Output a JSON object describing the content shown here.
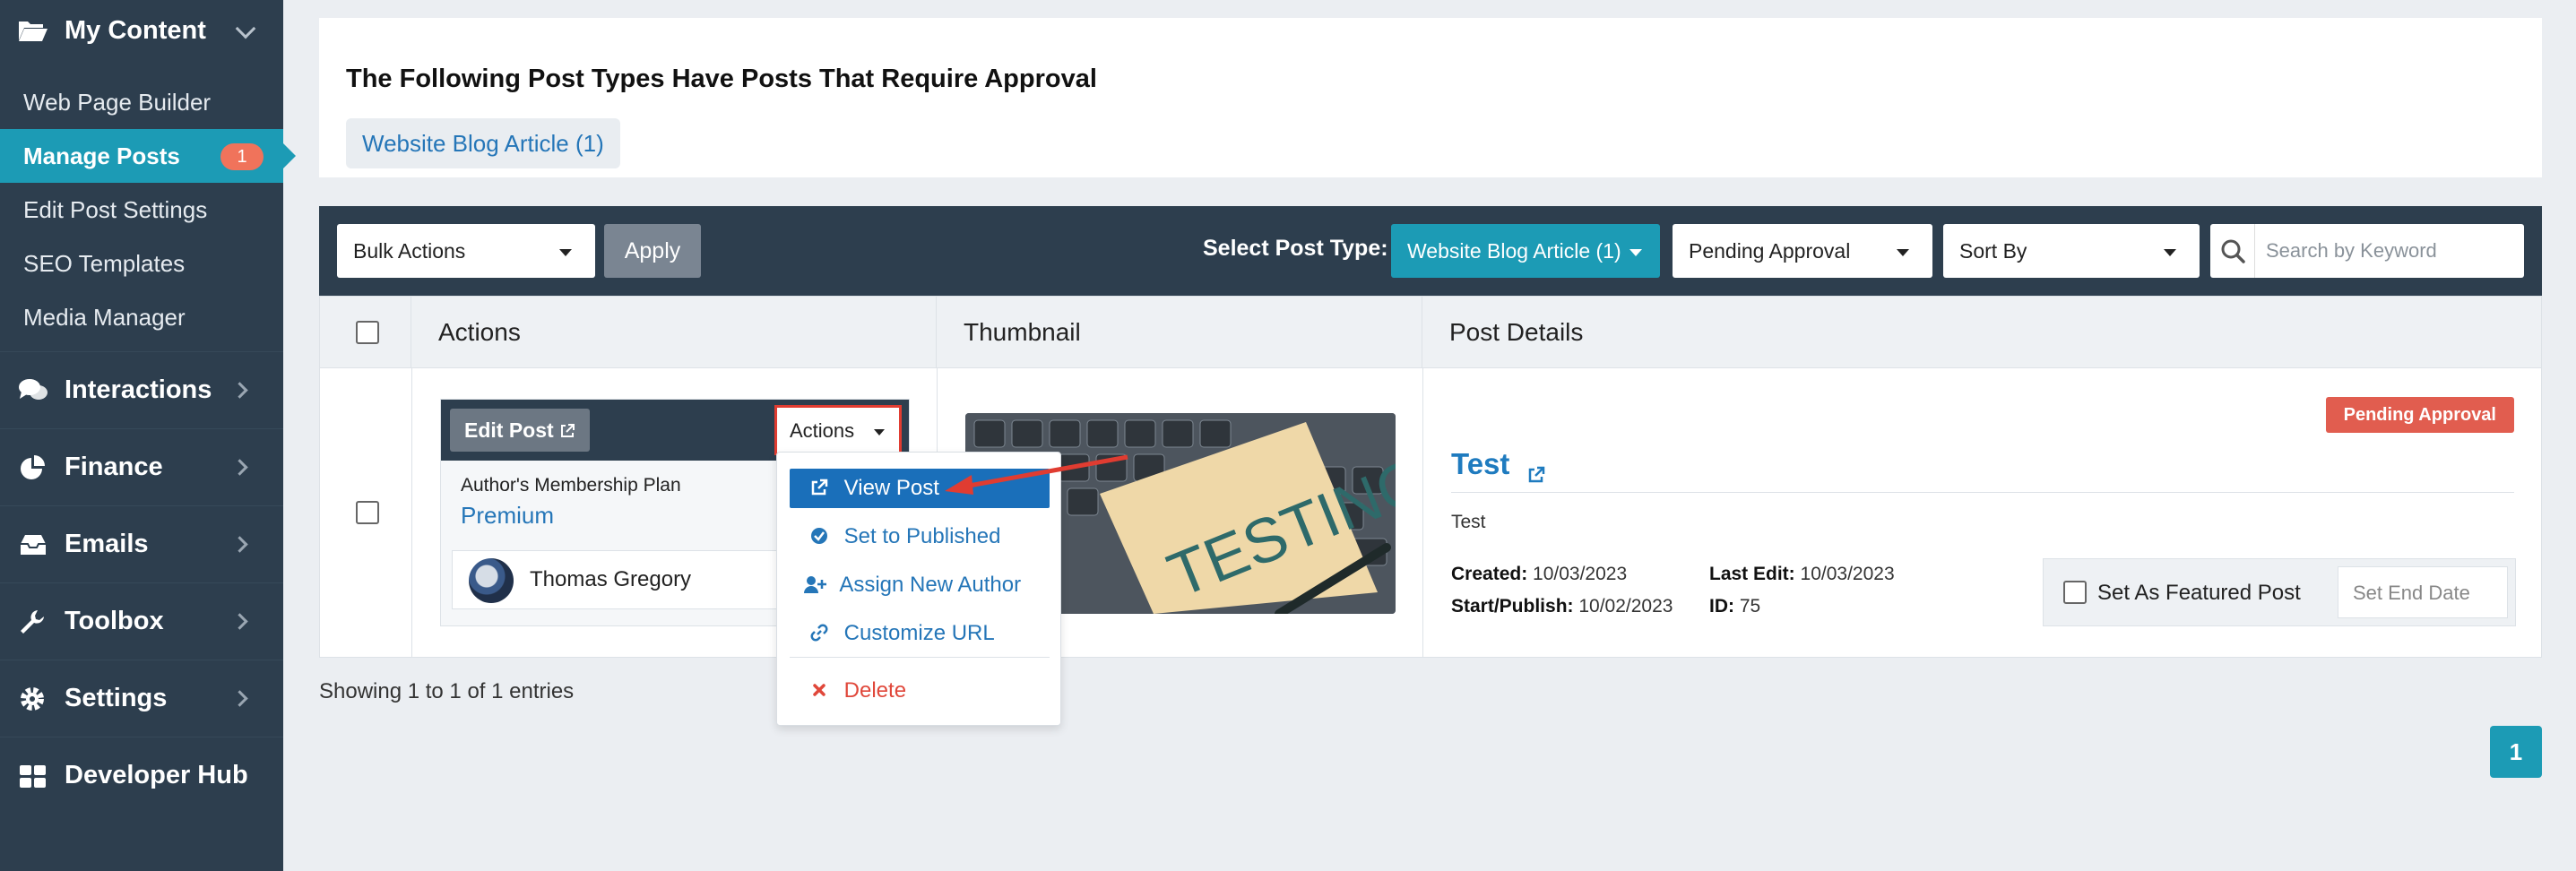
{
  "sidebar": {
    "header": {
      "label": "My Content",
      "icon": "folder-open-icon"
    },
    "sub_items": [
      {
        "label": "Web Page Builder"
      },
      {
        "label": "Manage Posts",
        "badge": "1",
        "active": true
      },
      {
        "label": "Edit Post Settings"
      },
      {
        "label": "SEO Templates"
      },
      {
        "label": "Media Manager"
      }
    ],
    "main_items": [
      {
        "label": "Interactions",
        "icon": "comments-icon"
      },
      {
        "label": "Finance",
        "icon": "pie-chart-icon"
      },
      {
        "label": "Emails",
        "icon": "inbox-icon"
      },
      {
        "label": "Toolbox",
        "icon": "wrench-icon"
      },
      {
        "label": "Settings",
        "icon": "gear-icon"
      },
      {
        "label": "Developer Hub",
        "icon": "grid-icon"
      }
    ]
  },
  "approval": {
    "title": "The Following Post Types Have Posts That Require Approval",
    "chip": "Website Blog Article (1)"
  },
  "toolbar": {
    "bulk_actions": "Bulk Actions",
    "apply": "Apply",
    "post_type_label": "Select Post Type:",
    "post_type": "Website Blog Article (1)",
    "status_filter": "Pending Approval",
    "sort_by": "Sort By",
    "search_placeholder": "Search by Keyword"
  },
  "table": {
    "headers": {
      "actions": "Actions",
      "thumbnail": "Thumbnail",
      "post_details": "Post Details"
    },
    "row": {
      "edit_post": "Edit Post",
      "actions": "Actions",
      "membership_label": "Author's Membership Plan",
      "membership_value": "Premium",
      "author": "Thomas Gregory",
      "thumbnail_text": "TESTING",
      "status": "Pending Approval",
      "title": "Test",
      "excerpt": "Test",
      "created_label": "Created:",
      "created": "10/03/2023",
      "last_edit_label": "Last Edit:",
      "last_edit": "10/03/2023",
      "start_label": "Start/Publish:",
      "start": "10/02/2023",
      "id_label": "ID:",
      "id": "75",
      "featured_label": "Set As Featured Post",
      "end_date_placeholder": "Set End Date"
    }
  },
  "dropdown": {
    "items": [
      {
        "label": "View Post",
        "icon": "external-link-icon",
        "active": true
      },
      {
        "label": "Set to Published",
        "icon": "check-circle-icon"
      },
      {
        "label": "Assign New Author",
        "icon": "user-plus-icon"
      },
      {
        "label": "Customize URL",
        "icon": "link-icon"
      },
      {
        "label": "Delete",
        "icon": "close-icon",
        "danger": true
      }
    ]
  },
  "footer": {
    "entries": "Showing 1 to 1 of 1 entries",
    "page": "1"
  },
  "colors": {
    "sidebar": "#2d3e4e",
    "accent": "#1c9bb5",
    "link": "#2576b8",
    "danger": "#e15d4f",
    "highlight": "#e03c31"
  }
}
